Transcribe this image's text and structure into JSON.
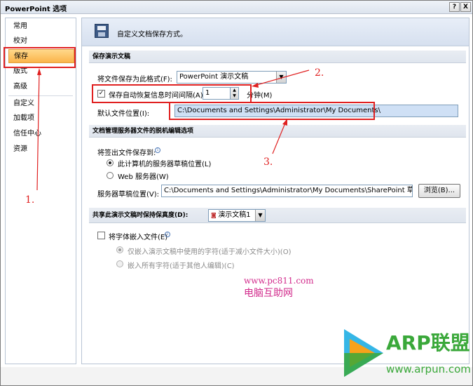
{
  "window": {
    "title": "PowerPoint 选项",
    "help_label": "?",
    "close_label": "X"
  },
  "sidebar": {
    "items": [
      {
        "label": "常用"
      },
      {
        "label": "校对"
      },
      {
        "label": "保存"
      },
      {
        "label": "版式"
      },
      {
        "label": "高级"
      },
      {
        "label": "自定义"
      },
      {
        "label": "加载项"
      },
      {
        "label": "信任中心"
      },
      {
        "label": "资源"
      }
    ],
    "selected": "保存"
  },
  "banner": {
    "text": "自定义文档保存方式。",
    "icon": "save-icon"
  },
  "save_section": {
    "title": "保存演示文稿",
    "format_label": "将文件保存为此格式(F):",
    "format_value": "PowerPoint 演示文稿",
    "autorecover_label": "保存自动恢复信息时间间隔(A)",
    "autorecover_checked": true,
    "autorecover_value": "1",
    "minutes_label": "分钟(M)",
    "default_location_label": "默认文件位置(I):",
    "default_location_value": "C:\\Documents and Settings\\Administrator\\My Documents\\"
  },
  "server_section": {
    "title": "文档管理服务器文件的脱机编辑选项",
    "save_to_label": "将签出文件保存到:",
    "radio_local_label": "此计算机的服务器草稿位置(L)",
    "radio_local_checked": true,
    "radio_web_label": "Web 服务器(W)",
    "drafts_label": "服务器草稿位置(V):",
    "drafts_value": "C:\\Documents and Settings\\Administrator\\My Documents\\SharePoint 草稿\\",
    "browse_label": "浏览(B)..."
  },
  "fidelity_section": {
    "title": "共享此演示文稿时保持保真度(D):",
    "doc_value": "演示文稿1",
    "embed_label": "将字体嵌入文件(E)",
    "embed_checked": false,
    "embed_used_label": "仅嵌入演示文稿中使用的字符(适于减小文件大小)(O)",
    "embed_all_label": "嵌入所有字符(适于其他人编辑)(C)"
  },
  "annotations": {
    "n1": "1.",
    "n2": "2.",
    "n3": "3."
  },
  "watermark": {
    "url": "www.pc811.com",
    "name": "电脑互助网"
  },
  "logo": {
    "brand": "ARP联盟",
    "url": "www.arpun.com"
  },
  "colors": {
    "annotation_red": "#e02020",
    "selected_orange": "#fbb44a",
    "watermark_pink": "#d22b8c",
    "logo_green": "#3aa83a"
  }
}
